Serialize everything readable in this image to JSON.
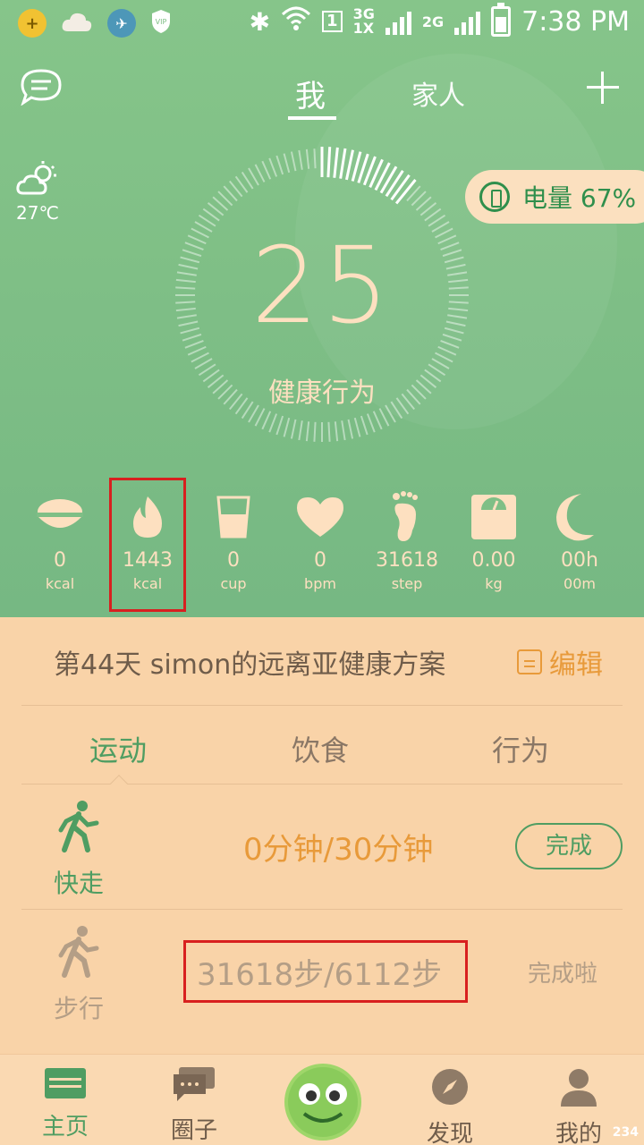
{
  "statusbar": {
    "time": "7:38 PM",
    "sim1": "1",
    "net_3g": "3G",
    "net_1x": "1X",
    "net_2g": "2G",
    "icons": [
      "coin-icon",
      "cloud-icon",
      "bird-icon",
      "shield-icon",
      "bluetooth-icon",
      "wifi-icon",
      "signal-icon",
      "battery-icon"
    ]
  },
  "nav": {
    "tab_me": "我",
    "tab_family": "家人",
    "chat_icon": "chat-bubble-icon",
    "add_icon": "plus-icon"
  },
  "weather": {
    "temp": "27℃",
    "icon": "partly-cloudy-icon"
  },
  "battery_pill": {
    "label": "电量 67%",
    "icon": "wristband-icon"
  },
  "dial": {
    "value": "25",
    "label": "健康行为"
  },
  "stats": [
    {
      "icon": "bowl-icon",
      "value": "0",
      "unit": "kcal"
    },
    {
      "icon": "flame-icon",
      "value": "1443",
      "unit": "kcal"
    },
    {
      "icon": "cup-icon",
      "value": "0",
      "unit": "cup"
    },
    {
      "icon": "heart-icon",
      "value": "0",
      "unit": "bpm"
    },
    {
      "icon": "footprint-icon",
      "value": "31618",
      "unit": "step"
    },
    {
      "icon": "scale-icon",
      "value": "0.00",
      "unit": "kg"
    },
    {
      "icon": "moon-icon",
      "value": "00h",
      "unit": "00m"
    }
  ],
  "plan": {
    "title": "第44天 simon的远离亚健康方案",
    "edit": "编辑"
  },
  "tabs": {
    "sport": "运动",
    "diet": "饮食",
    "behavior": "行为"
  },
  "rows": [
    {
      "label": "快走",
      "progress": "0分钟/30分钟",
      "action": "完成"
    },
    {
      "label": "步行",
      "progress": "31618步/6112步",
      "status": "完成啦"
    }
  ],
  "bottom_tabs": {
    "home": "主页",
    "circle": "圈子",
    "discover": "发现",
    "mine": "我的"
  },
  "watermark": "234",
  "colors": {
    "green": "#4f9d62",
    "orange": "#e89a3a",
    "highlight": "#d8201f",
    "peach": "#f9d3a8"
  }
}
